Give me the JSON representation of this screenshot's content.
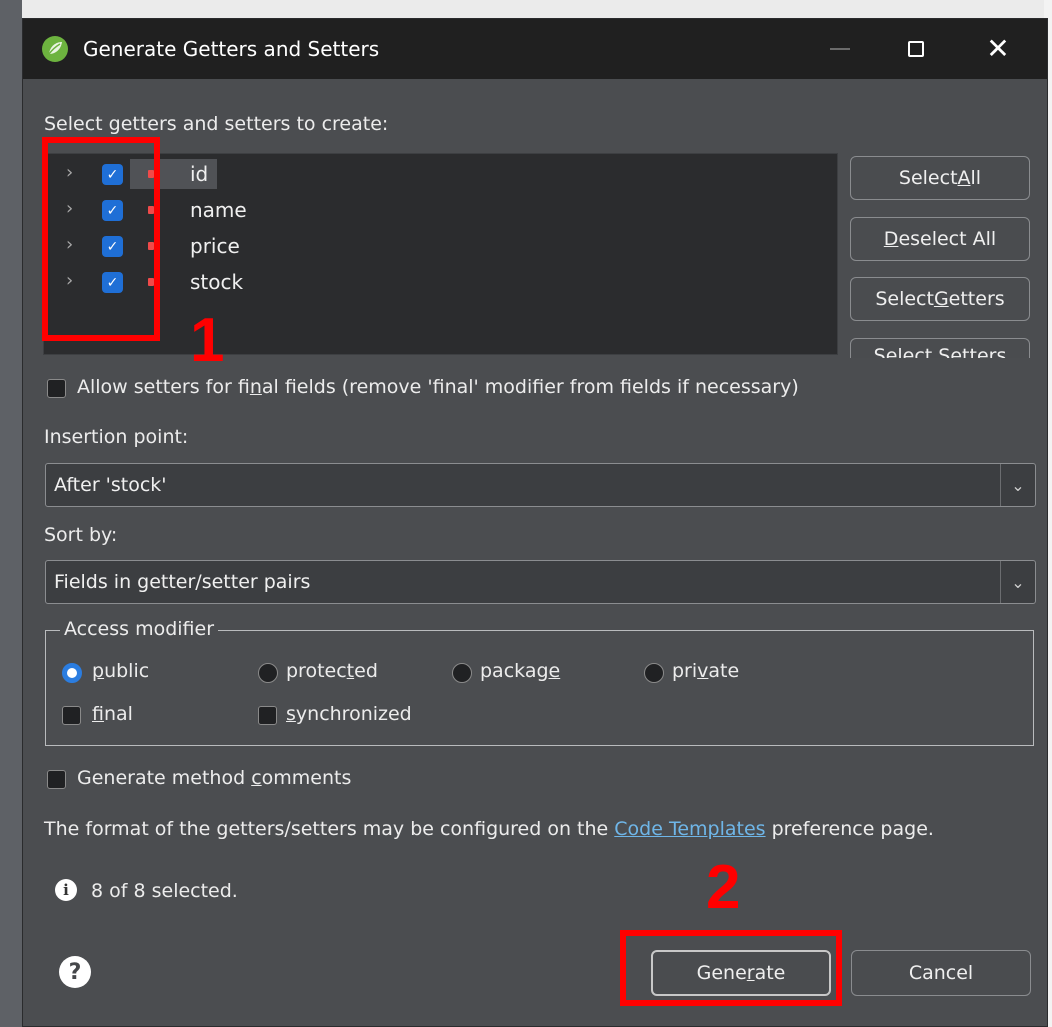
{
  "window": {
    "title": "Generate Getters and Setters"
  },
  "prompt": "Select getters and setters to create:",
  "fields": [
    {
      "name": "id",
      "checked": true
    },
    {
      "name": "name",
      "checked": true
    },
    {
      "name": "price",
      "checked": true
    },
    {
      "name": "stock",
      "checked": true
    }
  ],
  "side_buttons": {
    "select_all": {
      "pre": "Select ",
      "mn": "A",
      "post": "ll"
    },
    "deselect_all": {
      "pre": "",
      "mn": "D",
      "post": "eselect All"
    },
    "select_getters": {
      "pre": "Select ",
      "mn": "G",
      "post": "etters"
    },
    "select_setters_partial": "Select Setters"
  },
  "allow_final": {
    "pre": "Allow setters for fi",
    "mn": "n",
    "post": "al fields (remove 'final' modifier from fields if necessary)"
  },
  "insertion": {
    "label": "Insertion point:",
    "value": "After 'stock'"
  },
  "sort": {
    "label": "Sort by:",
    "value": "Fields in getter/setter pairs"
  },
  "access": {
    "title": "Access modifier",
    "public": {
      "pre": "",
      "mn": "p",
      "post": "ublic"
    },
    "protected": {
      "pre": "protec",
      "mn": "t",
      "post": "ed"
    },
    "package": {
      "pre": "packag",
      "mn": "e",
      "post": ""
    },
    "private": {
      "pre": "pri",
      "mn": "v",
      "post": "ate"
    },
    "final": {
      "pre": "",
      "mn": "f",
      "post": "inal"
    },
    "synchronized": {
      "pre": "",
      "mn": "s",
      "post": "ynchronized"
    }
  },
  "comments": {
    "pre": "Generate method ",
    "mn": "c",
    "post": "omments"
  },
  "format": {
    "pre": "The format of the getters/setters may be configured on the ",
    "link": "Code Templates",
    "post": " preference page."
  },
  "status": "8 of 8 selected.",
  "footer": {
    "generate": {
      "pre": "Gene",
      "mn": "r",
      "post": "ate"
    },
    "cancel": "Cancel"
  },
  "annotations": {
    "one": "1",
    "two": "2"
  },
  "colors": {
    "accent": "#1f6fd6",
    "annotation": "#ff0000",
    "link": "#6fb6e8"
  }
}
